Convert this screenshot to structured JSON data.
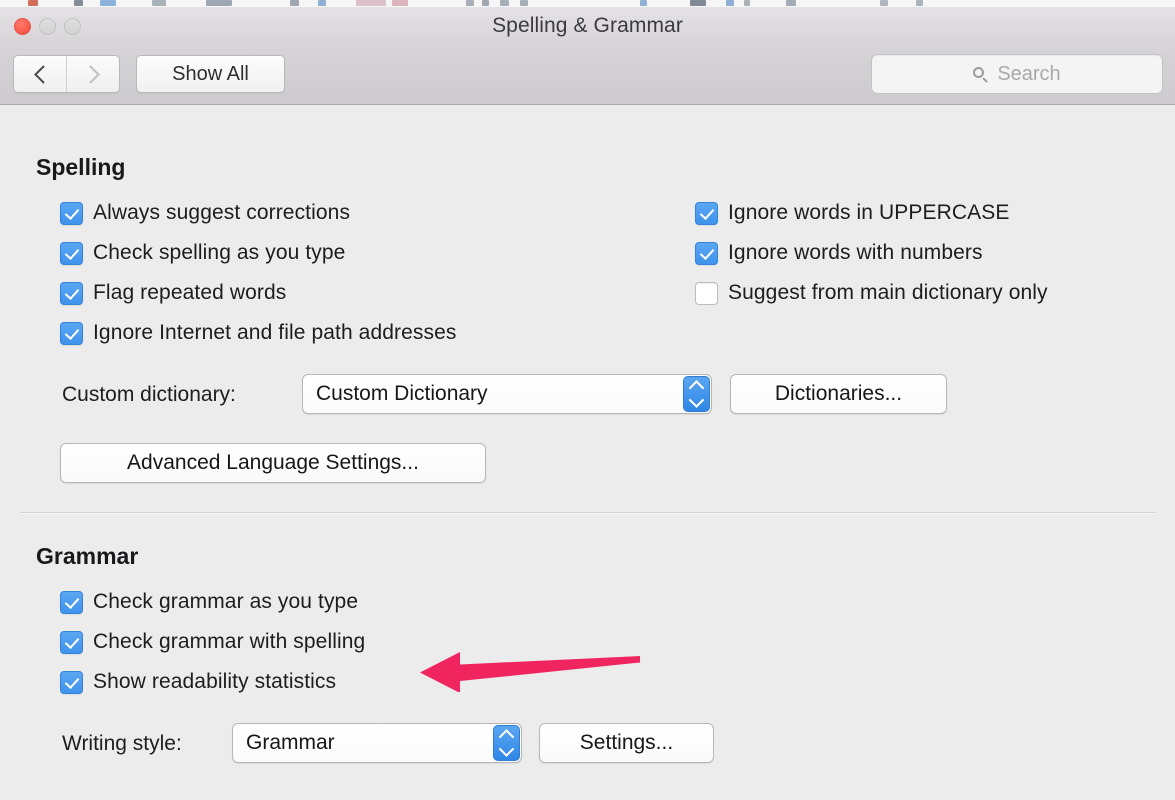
{
  "window": {
    "title": "Spelling & Grammar",
    "traffic_lights": [
      "close",
      "minimize",
      "zoom"
    ]
  },
  "toolbar": {
    "back_icon": "chevron-left-icon",
    "forward_icon": "chevron-right-icon",
    "show_all_label": "Show All",
    "search": {
      "icon": "search-icon",
      "placeholder": "Search",
      "value": ""
    }
  },
  "spelling": {
    "heading": "Spelling",
    "left_options": [
      {
        "label": "Always suggest corrections",
        "checked": true
      },
      {
        "label": "Check spelling as you type",
        "checked": true
      },
      {
        "label": "Flag repeated words",
        "checked": true
      },
      {
        "label": "Ignore Internet and file path addresses",
        "checked": true
      }
    ],
    "right_options": [
      {
        "label": "Ignore words in UPPERCASE",
        "checked": true
      },
      {
        "label": "Ignore words with numbers",
        "checked": true
      },
      {
        "label": "Suggest from main dictionary only",
        "checked": false
      }
    ],
    "custom_dictionary": {
      "label": "Custom dictionary:",
      "value": "Custom Dictionary",
      "stepper_icon": "chevron-up-down-icon"
    },
    "dictionaries_button": "Dictionaries...",
    "advanced_button": "Advanced Language Settings..."
  },
  "grammar": {
    "heading": "Grammar",
    "options": [
      {
        "label": "Check grammar as you type",
        "checked": true
      },
      {
        "label": "Check grammar with spelling",
        "checked": true
      },
      {
        "label": "Show readability statistics",
        "checked": true
      }
    ],
    "writing_style": {
      "label": "Writing style:",
      "value": "Grammar",
      "stepper_icon": "chevron-up-down-icon"
    },
    "settings_button": "Settings..."
  },
  "annotation": {
    "type": "arrow-left",
    "color": "#f0255f",
    "points_at": "Show readability statistics"
  },
  "colors": {
    "accent_blue": "#3f93ec",
    "window_background": "#ececec",
    "toolbar_background": "#d2d0d3",
    "annotation_pink": "#f0255f"
  }
}
